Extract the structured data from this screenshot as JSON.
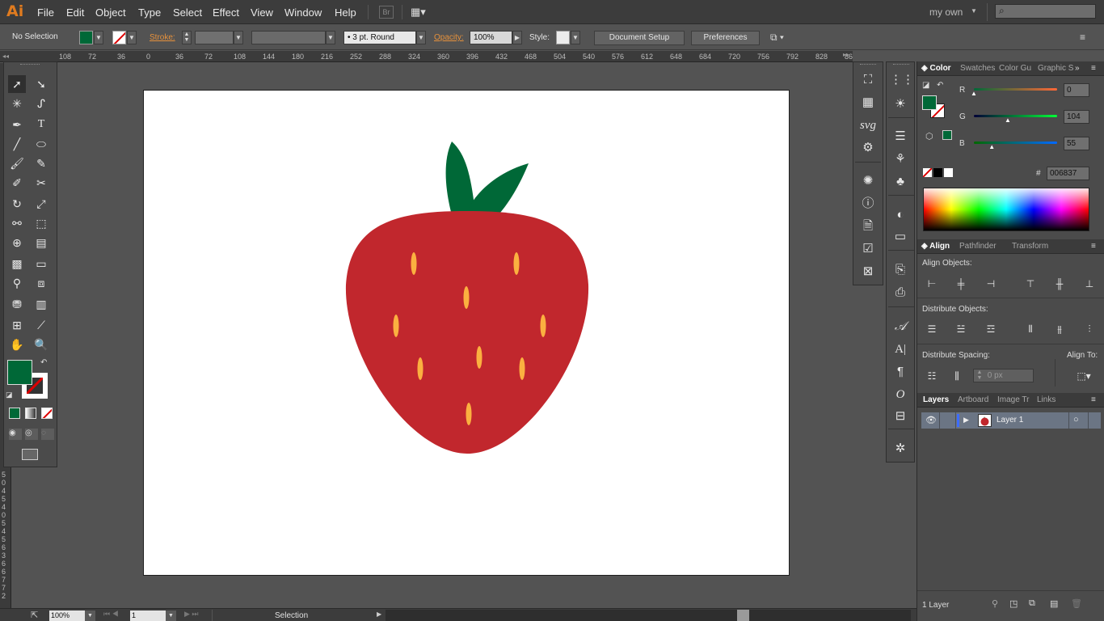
{
  "app": {
    "logo": "Ai"
  },
  "menu": [
    "File",
    "Edit",
    "Object",
    "Type",
    "Select",
    "Effect",
    "View",
    "Window",
    "Help"
  ],
  "bridge_label": "Br",
  "workspace": {
    "label": "my own",
    "search_placeholder": ""
  },
  "controlbar": {
    "selection": "No Selection",
    "stroke_label": "Stroke:",
    "brush": "3 pt. Round",
    "opacity_label": "Opacity:",
    "opacity": "100%",
    "style_label": "Style:",
    "document_setup": "Document Setup",
    "preferences": "Preferences"
  },
  "ruler_ticks": [
    "108",
    "72",
    "36",
    "0",
    "36",
    "72",
    "108",
    "144",
    "180",
    "216",
    "252",
    "288",
    "324",
    "360",
    "396",
    "432",
    "468",
    "504",
    "540",
    "576",
    "612",
    "648",
    "684",
    "720",
    "756",
    "792",
    "828",
    "86"
  ],
  "vruler_labels": [
    "5",
    "0",
    "4",
    "5",
    "4",
    "0",
    "5",
    "4",
    "5",
    "6",
    "3",
    "6",
    "6",
    "7",
    "7",
    "2"
  ],
  "colors": {
    "fill": "#006837",
    "strawberry": "#c1272d",
    "leaf": "#006837",
    "seed": "#fbb040"
  },
  "color_panel": {
    "tabs": [
      "Color",
      "Swatches",
      "Color Gu",
      "Graphic S"
    ],
    "r_label": "R",
    "g_label": "G",
    "b_label": "B",
    "r": "0",
    "g": "104",
    "b": "55",
    "r_value": 0,
    "g_value": 104,
    "b_value": 55,
    "hash": "#",
    "hex": "006837"
  },
  "align_panel": {
    "tabs": [
      "Align",
      "Pathfinder",
      "Transform"
    ],
    "align_objects": "Align Objects:",
    "distribute_objects": "Distribute Objects:",
    "distribute_spacing": "Distribute Spacing:",
    "align_to": "Align To:",
    "spacing_value": "0 px"
  },
  "layers_panel": {
    "tabs": [
      "Layers",
      "Artboard",
      "Image Tr",
      "Links"
    ],
    "layer_name": "Layer 1",
    "count": "1 Layer"
  },
  "statusbar": {
    "zoom": "100%",
    "artboard": "1",
    "tool": "Selection"
  },
  "dock_svg_label": "svg"
}
